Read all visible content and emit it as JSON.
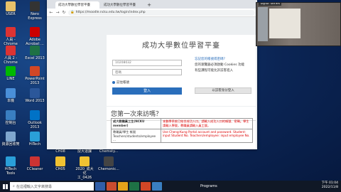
{
  "desktop_icons": [
    {
      "id": "user",
      "label": "USER",
      "color": "#e8c26a"
    },
    {
      "id": "nero",
      "label": "Nero Express",
      "color": "#333"
    },
    {
      "id": "in1",
      "label": "人員 -\nChrome",
      "color": "#d33"
    },
    {
      "id": "acrobat",
      "label": "Adobe\nAcrobat ...",
      "color": "#c00"
    },
    {
      "id": "in2",
      "label": "人員 2 -\nChrome",
      "color": "#d33"
    },
    {
      "id": "excel",
      "label": "Excel 2013",
      "color": "#1e7145"
    },
    {
      "id": "line",
      "label": "LINE",
      "color": "#00b900"
    },
    {
      "id": "ppt",
      "label": "PowerPoint\n2013",
      "color": "#d24726"
    },
    {
      "id": "pc",
      "label": "本機",
      "color": "#4a8fd8"
    },
    {
      "id": "word",
      "label": "Word 2013",
      "color": "#2b579a"
    },
    {
      "id": "ctrl",
      "label": "控制台",
      "color": "#3a7fc1"
    },
    {
      "id": "outlook",
      "label": "Outlook\n2013",
      "color": "#0072c6"
    },
    {
      "id": "recycle",
      "label": "資源回收筒",
      "color": "#7fa7cf"
    },
    {
      "id": "hitech",
      "label": "HiTech",
      "color": "#2a9fd8"
    },
    {
      "id": "ch08",
      "label": "CH08",
      "color": "#f1c232"
    },
    {
      "id": "teach",
      "label": "授大道課",
      "color": "#f1c232"
    },
    {
      "id": "chem",
      "label": "Chemsty...",
      "color": "#f1c232"
    },
    {
      "id": "hitools",
      "label": "HiTech\nTools",
      "color": "#2a9fd8"
    },
    {
      "id": "ccleaner",
      "label": "CCleaner",
      "color": "#c33"
    },
    {
      "id": "ch05",
      "label": "CH05",
      "color": "#f1c232"
    },
    {
      "id": "cv2020",
      "label": "2020_成大化\n工_0426",
      "color": "#f1c232"
    },
    {
      "id": "chemonic",
      "label": "Chemonic...",
      "color": "#444"
    }
  ],
  "browser": {
    "tabs": [
      "成功大學數位學習平臺",
      "成功大學數位學習平臺",
      "Taylor series"
    ],
    "url": "https://moodle.ncku.edu.tw/login/index.php",
    "lock_icon": "lock-icon"
  },
  "login": {
    "title": "成功大學數位學習平臺",
    "username_value": "10208032",
    "password_placeholder": "密碼",
    "remember_label": "記住帳號",
    "login_button": "登入",
    "forgot_link": "忘記您的帳號或密碼？",
    "cookie_text": "您的瀏覽器必須啟動 Cookies 功能",
    "guest_note": "有些課程可能允許訪客進入",
    "guest_button": "以訪客身分登入"
  },
  "first_time": {
    "title": "您第一次來訪嗎？",
    "rows": [
      {
        "col1": "成大教職員工生(NCKU member)",
        "col2": "本數學系統已結合成功入口。請輸入成功入口的帳號、密碼。學生請輸入學號，教職員請輸入員工號。"
      },
      {
        "col1": "教職員/學生 帳號\nTeachers/students/employee ...",
        "col2": "Use Cheng-Kung Portal account and password. Student: input Student No. Teachers/employee: input employee No."
      }
    ]
  },
  "taskbar": {
    "search_placeholder": "在這裡輸入文字來搜尋",
    "programs_label": "Programs",
    "time": "下午 01:04",
    "date": "2022/11/8"
  }
}
